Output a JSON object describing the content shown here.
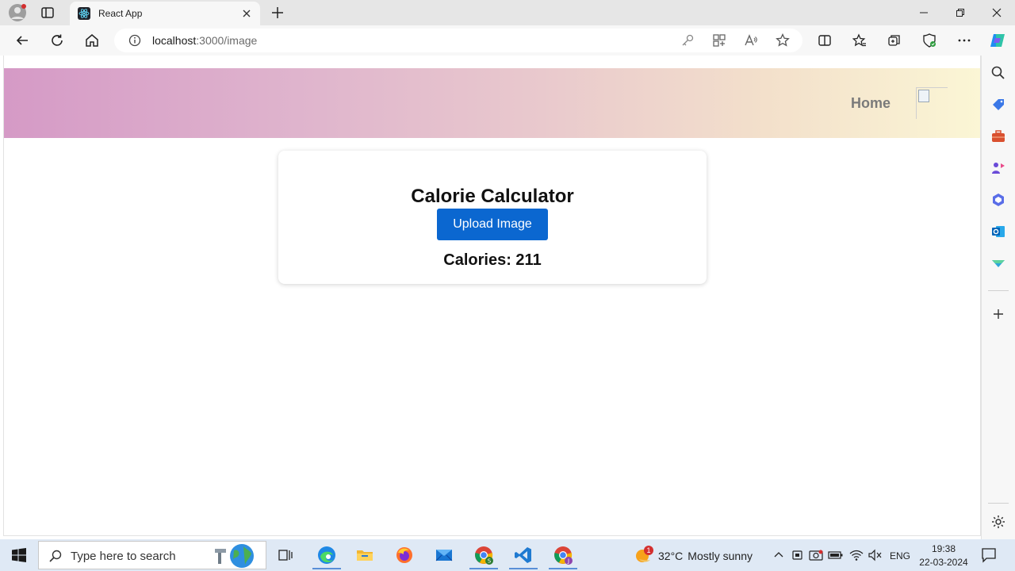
{
  "browser": {
    "tab_title": "React App",
    "url_host": "localhost",
    "url_rest": ":3000/image"
  },
  "app": {
    "nav": {
      "home_label": "Home"
    },
    "card": {
      "title": "Calorie Calculator",
      "upload_label": "Upload Image",
      "calories_label": "Calories: 211"
    }
  },
  "taskbar": {
    "search_placeholder": "Type here to search",
    "weather": {
      "temp": "32°C",
      "condition": "Mostly sunny",
      "badge": "1"
    },
    "language": "ENG",
    "time": "19:38",
    "date": "22-03-2024"
  },
  "colors": {
    "accent": "#0b67d0",
    "banner_start": "#d59ac6",
    "banner_end": "#fbf6d5"
  }
}
